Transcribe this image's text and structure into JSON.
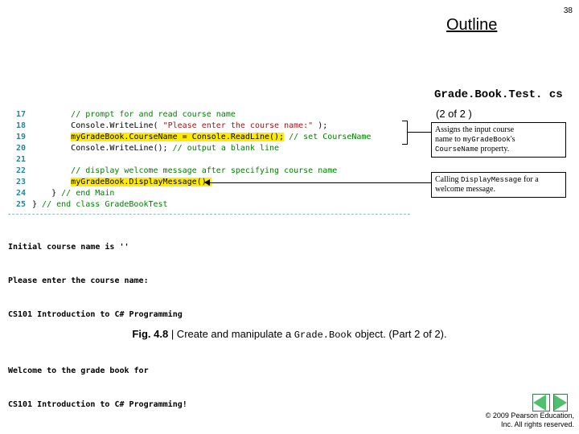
{
  "page_number": "38",
  "header": {
    "outline": "Outline"
  },
  "file": {
    "name": "Grade.Book.Test. cs",
    "part": "(2 of 2 )"
  },
  "code": {
    "l17": {
      "n": "17",
      "indent": "        ",
      "c": "// prompt for and read course name"
    },
    "l18": {
      "n": "18",
      "indent": "        ",
      "a": "Console.WriteLine( ",
      "s": "\"Please enter the course name:\"",
      "b": " );"
    },
    "l19": {
      "n": "19",
      "indent": "        ",
      "hl": "myGradeBook.CourseName = Console.ReadLine();",
      "c": " // set CourseName"
    },
    "l20": {
      "n": "20",
      "indent": "        ",
      "a": "Console.WriteLine(); ",
      "c": "// output a blank line"
    },
    "l21": {
      "n": "21"
    },
    "l22": {
      "n": "22",
      "indent": "        ",
      "c": "// display welcome message after specifying course name"
    },
    "l23": {
      "n": "23",
      "indent": "        ",
      "hl": "myGradeBook.DisplayMessage();"
    },
    "l24": {
      "n": "24",
      "indent": "    ",
      "a": "} ",
      "c": "// end Main"
    },
    "l25": {
      "n": "25",
      "a": "} ",
      "c": "// end class GradeBookTest"
    }
  },
  "output": {
    "l1": "Initial course name is ''",
    "l2": "Please enter the course name:",
    "l3": "CS101 Introduction to C# Programming",
    "l4": "",
    "l5": "Welcome to the grade book for",
    "l6": "CS101 Introduction to C# Programming!"
  },
  "annot1": {
    "t1": "Assigns the input course",
    "t2a": "name to ",
    "t2b": "myGradeBook",
    "t2c": "'s",
    "t3a": "CourseName",
    "t3b": " property."
  },
  "annot2": {
    "t1a": "Calling ",
    "t1b": "DisplayMessage",
    "t1c": " for a",
    "t2": "welcome message."
  },
  "caption": {
    "fig": "Fig. 4.8",
    "mid": " | Create and manipulate a ",
    "cls": "Grade.Book",
    "end": " object. (Part 2 of 2)."
  },
  "footer": {
    "l1": "© 2009 Pearson Education,",
    "l2": "Inc.  All rights reserved."
  }
}
